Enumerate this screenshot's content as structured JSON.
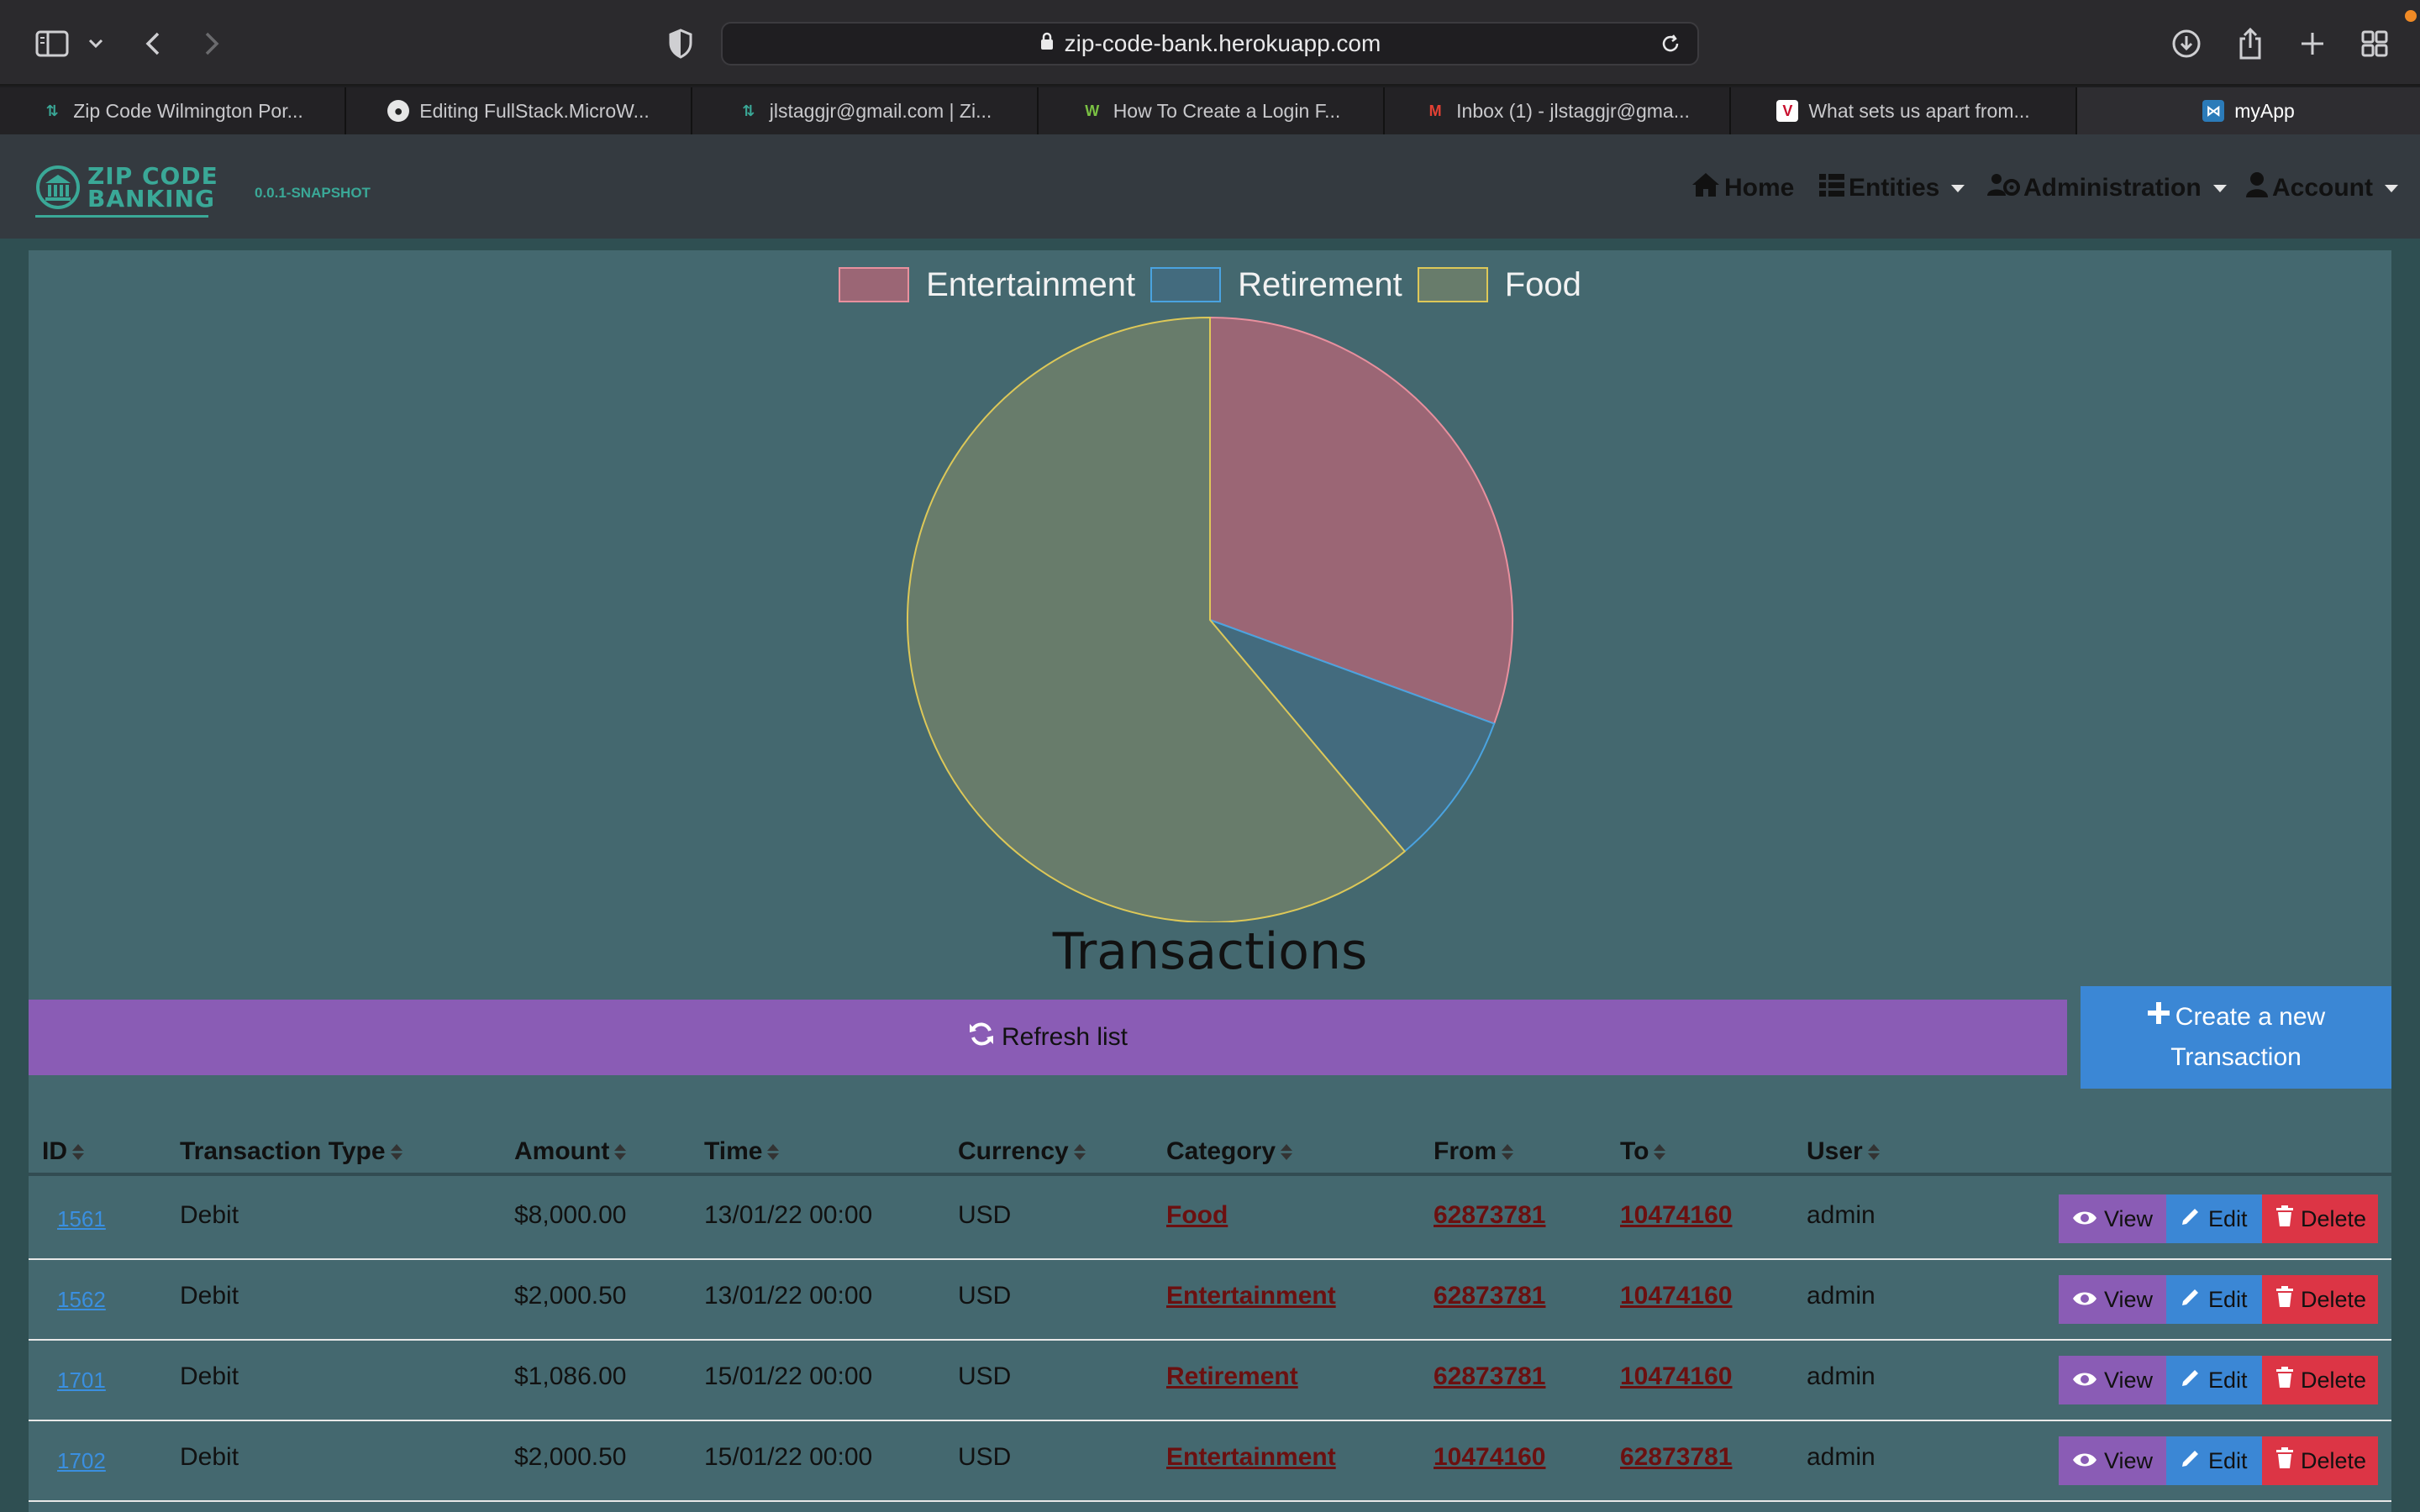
{
  "browser": {
    "url": "zip-code-bank.herokuapp.com",
    "tabs": [
      {
        "label": "Zip Code Wilmington Por...",
        "icon": "zipcode-favicon"
      },
      {
        "label": "Editing FullStack.MicroW...",
        "icon": "github-favicon"
      },
      {
        "label": "jlstaggjr@gmail.com | Zi...",
        "icon": "zipcode-favicon"
      },
      {
        "label": "How To Create a Login F...",
        "icon": "w-favicon"
      },
      {
        "label": "Inbox (1) - jlstaggjr@gma...",
        "icon": "gmail-favicon"
      },
      {
        "label": "What sets us apart from...",
        "icon": "v-favicon"
      },
      {
        "label": "myApp",
        "icon": "jhipster-favicon"
      }
    ]
  },
  "app": {
    "brand_line1": "ZIP CODE",
    "brand_line2": "BANKING",
    "version": "0.0.1-SNAPSHOT",
    "nav": {
      "home": "Home",
      "entities": "Entities",
      "administration": "Administration",
      "account": "Account"
    }
  },
  "chart_data": {
    "type": "pie",
    "categories": [
      "Entertainment",
      "Retirement",
      "Food"
    ],
    "values": [
      4001.0,
      1086.0,
      8000.0
    ],
    "colors": [
      "#9b6675",
      "#436b7e",
      "#687c6b"
    ],
    "border_colors": [
      "#e8909e",
      "#4aa3e0",
      "#ddc858"
    ],
    "legend": "top"
  },
  "page": {
    "title": "Transactions",
    "refresh_label": "Refresh list",
    "create_label_1": "Create a new",
    "create_label_2": "Transaction"
  },
  "table": {
    "headers": [
      "ID",
      "Transaction Type",
      "Amount",
      "Time",
      "Currency",
      "Category",
      "From",
      "To",
      "User"
    ],
    "rows": [
      {
        "id": "1561",
        "type": "Debit",
        "amount": "$8,000.00",
        "time": "13/01/22 00:00",
        "currency": "USD",
        "category": "Food",
        "from": "62873781",
        "to": "10474160",
        "user": "admin"
      },
      {
        "id": "1562",
        "type": "Debit",
        "amount": "$2,000.50",
        "time": "13/01/22 00:00",
        "currency": "USD",
        "category": "Entertainment",
        "from": "62873781",
        "to": "10474160",
        "user": "admin"
      },
      {
        "id": "1701",
        "type": "Debit",
        "amount": "$1,086.00",
        "time": "15/01/22 00:00",
        "currency": "USD",
        "category": "Retirement",
        "from": "62873781",
        "to": "10474160",
        "user": "admin"
      },
      {
        "id": "1702",
        "type": "Debit",
        "amount": "$2,000.50",
        "time": "15/01/22 00:00",
        "currency": "USD",
        "category": "Entertainment",
        "from": "10474160",
        "to": "62873781",
        "user": "admin"
      }
    ],
    "actions": {
      "view": "View",
      "edit": "Edit",
      "delete": "Delete"
    }
  }
}
